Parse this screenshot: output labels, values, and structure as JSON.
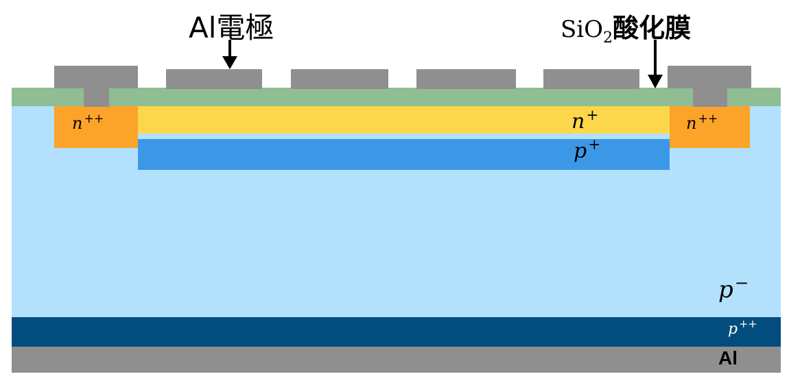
{
  "labels": {
    "al_electrode": "Al電極",
    "oxide_formula_base": "SiO",
    "oxide_formula_sub": "2",
    "oxide_name": "酸化膜",
    "al_bottom": "Al"
  },
  "regions": {
    "n_plusplus_left": {
      "base": "n",
      "sup": "++"
    },
    "n_plusplus_right": {
      "base": "n",
      "sup": "++"
    },
    "n_plus": {
      "base": "n",
      "sup": "+"
    },
    "p_plus": {
      "base": "p",
      "sup": "+"
    },
    "p_minus": {
      "base": "p",
      "sup": "−"
    },
    "p_plusplus": {
      "base": "p",
      "sup": "++"
    }
  },
  "colors": {
    "substrate": "#b3e0fc",
    "oxide": "#8fbe93",
    "electrode": "#8f8f8f",
    "n_plus": "#fdd74b",
    "p_plus": "#3d97e7",
    "n_plusplus": "#fca32a",
    "p_plusplus": "#024c7e"
  }
}
